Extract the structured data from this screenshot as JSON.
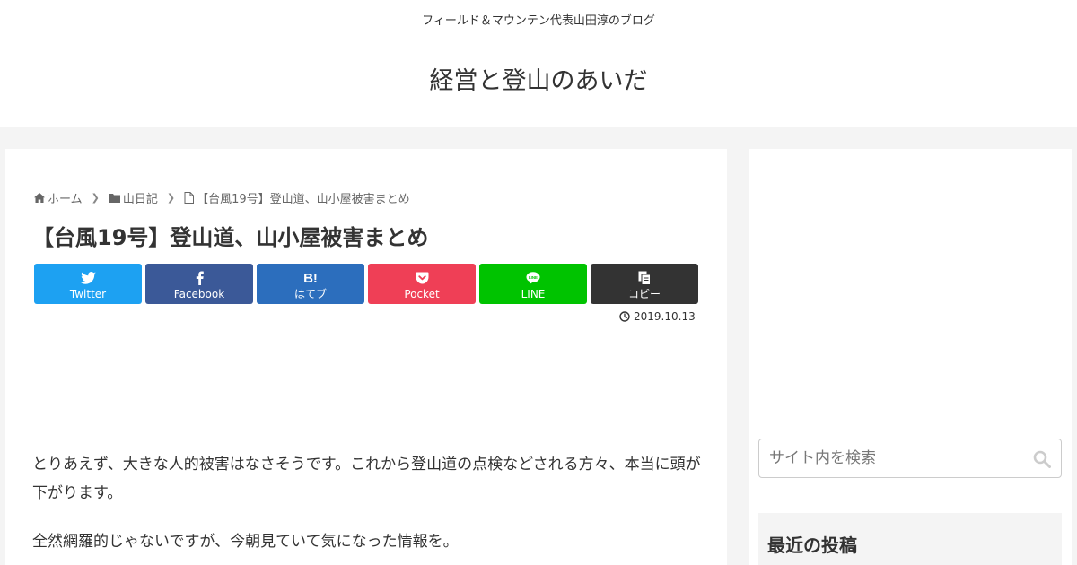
{
  "header": {
    "tagline": "フィールド＆マウンテン代表山田淳のブログ",
    "site_title": "経営と登山のあいだ"
  },
  "breadcrumb": {
    "home": "ホーム",
    "category": "山日記",
    "current": "【台風19号】登山道、山小屋被害まとめ"
  },
  "article": {
    "title": "【台風19号】登山道、山小屋被害まとめ",
    "date": "2019.10.13",
    "paragraphs": [
      "とりあえず、大きな人的被害はなさそうです。これから登山道の点検などされる方々、本当に頭が下がります。",
      "全然網羅的じゃないですが、今朝見ていて気になった情報を。"
    ]
  },
  "share": {
    "twitter": "Twitter",
    "facebook": "Facebook",
    "hatebu_mark": "B!",
    "hatebu": "はてブ",
    "pocket": "Pocket",
    "line": "LINE",
    "copy": "コピー"
  },
  "sidebar": {
    "search_placeholder": "サイト内を検索",
    "recent_heading": "最近の投稿"
  },
  "icons": {
    "home": "home-icon",
    "folder": "folder-icon",
    "file": "file-icon",
    "clock": "clock-icon",
    "search": "search-icon"
  },
  "colors": {
    "twitter": "#1da1f2",
    "facebook": "#3b5998",
    "hatebu": "#2c6ebd",
    "pocket": "#ef3f56",
    "line": "#00c300",
    "copy": "#333333"
  }
}
